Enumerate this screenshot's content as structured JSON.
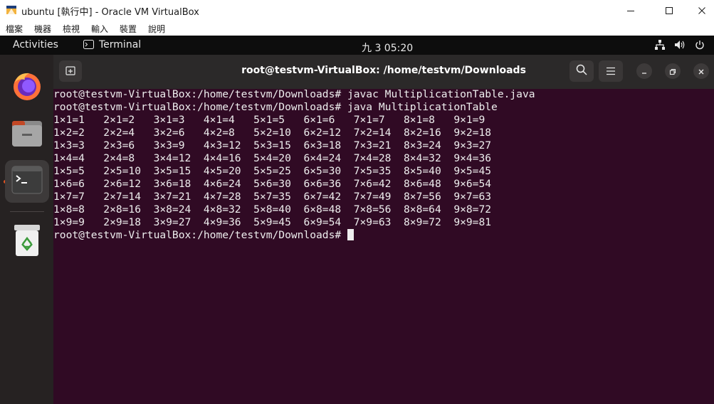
{
  "host_window": {
    "title": "ubuntu [執行中] - Oracle VM VirtualBox",
    "app_icon": "virtualbox-icon",
    "controls": {
      "minimize_icon": "minimize-icon",
      "maximize_icon": "maximize-icon",
      "close_icon": "close-icon"
    },
    "menu": [
      "檔案",
      "機器",
      "檢視",
      "輸入",
      "裝置",
      "說明"
    ]
  },
  "guest": {
    "topbar": {
      "activities_label": "Activities",
      "app_menu_label": "Terminal",
      "app_menu_icon": "terminal-icon",
      "clock": "九 3  05:20",
      "tray_icons": [
        "network-icon",
        "volume-icon",
        "power-icon"
      ]
    },
    "dock": {
      "items": [
        {
          "name": "firefox",
          "icon": "firefox-icon",
          "active": false
        },
        {
          "name": "files",
          "icon": "files-icon",
          "active": false
        },
        {
          "name": "terminal",
          "icon": "terminal-icon",
          "active": true
        },
        {
          "name": "trash",
          "icon": "trash-icon",
          "active": false
        }
      ]
    },
    "terminal": {
      "title": "root@testvm-VirtualBox: /home/testvm/Downloads",
      "header_icons": [
        "new-tab-icon",
        "search-icon",
        "menu-icon",
        "minimize-icon",
        "restore-icon",
        "close-icon"
      ],
      "colors": {
        "background": "#300a24",
        "foreground": "#eeeeee"
      },
      "lines": [
        "root@testvm-VirtualBox:/home/testvm/Downloads# javac MultiplicationTable.java",
        "root@testvm-VirtualBox:/home/testvm/Downloads# java MultiplicationTable",
        "1×1=1   2×1=2   3×1=3   4×1=4   5×1=5   6×1=6   7×1=7   8×1=8   9×1=9",
        "1×2=2   2×2=4   3×2=6   4×2=8   5×2=10  6×2=12  7×2=14  8×2=16  9×2=18",
        "1×3=3   2×3=6   3×3=9   4×3=12  5×3=15  6×3=18  7×3=21  8×3=24  9×3=27",
        "1×4=4   2×4=8   3×4=12  4×4=16  5×4=20  6×4=24  7×4=28  8×4=32  9×4=36",
        "1×5=5   2×5=10  3×5=15  4×5=20  5×5=25  6×5=30  7×5=35  8×5=40  9×5=45",
        "1×6=6   2×6=12  3×6=18  4×6=24  5×6=30  6×6=36  7×6=42  8×6=48  9×6=54",
        "1×7=7   2×7=14  3×7=21  4×7=28  5×7=35  6×7=42  7×7=49  8×7=56  9×7=63",
        "1×8=8   2×8=16  3×8=24  4×8=32  5×8=40  6×8=48  7×8=56  8×8=64  9×8=72",
        "1×9=9   2×9=18  3×9=27  4×9=36  5×9=45  6×9=54  7×9=63  8×9=72  9×9=81"
      ],
      "prompt": "root@testvm-VirtualBox:/home/testvm/Downloads# "
    }
  }
}
